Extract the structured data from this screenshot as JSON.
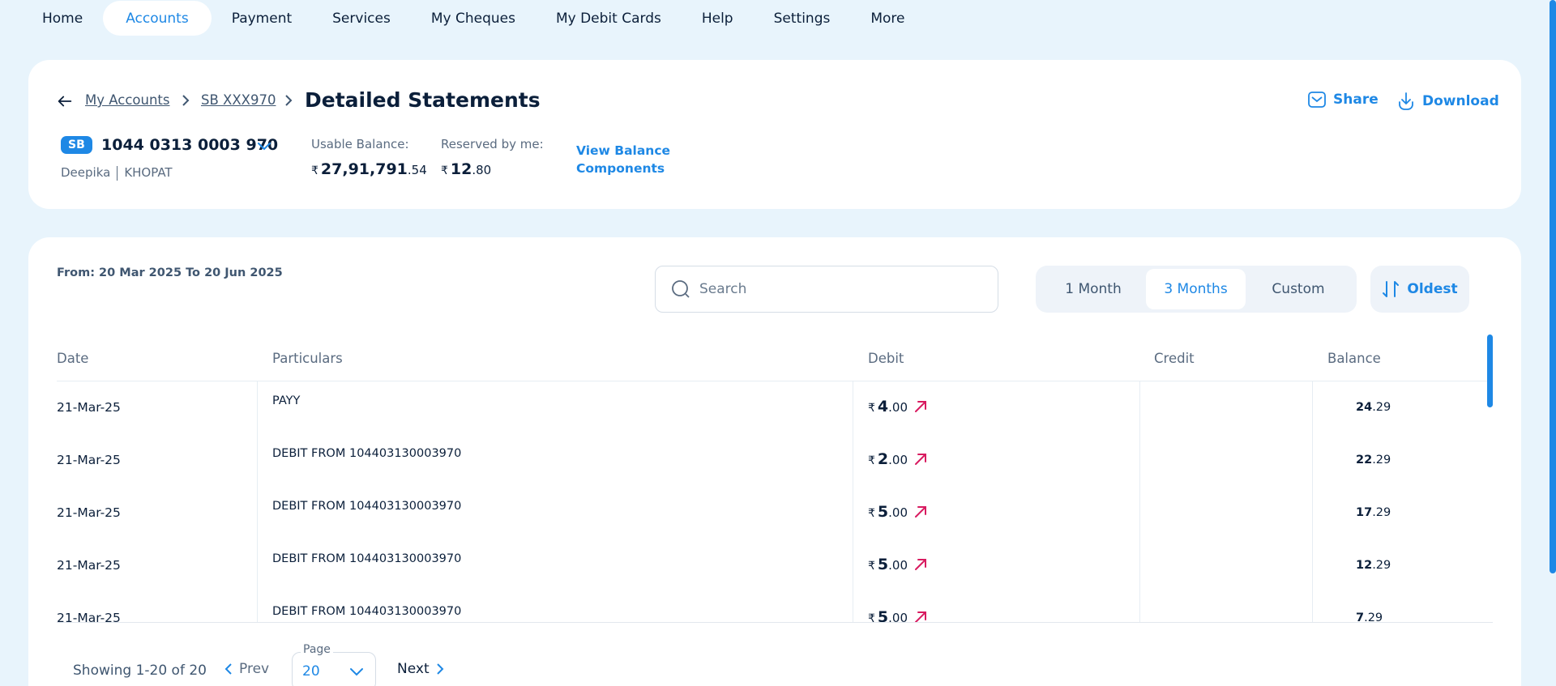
{
  "nav": {
    "items": [
      {
        "label": "Home"
      },
      {
        "label": "Accounts"
      },
      {
        "label": "Payment"
      },
      {
        "label": "Services"
      },
      {
        "label": "My Cheques"
      },
      {
        "label": "My Debit Cards"
      },
      {
        "label": "Help"
      },
      {
        "label": "Settings"
      },
      {
        "label": "More"
      }
    ],
    "active": "Accounts"
  },
  "breadcrumb": {
    "items": [
      "My Accounts",
      "SB XXX970"
    ],
    "title": "Detailed Statements"
  },
  "actions": {
    "share": "Share",
    "download": "Download"
  },
  "account": {
    "type_badge": "SB",
    "number": "1044 0313 0003 970",
    "holder_first": "Deepika",
    "holder_last": "KHOPAT"
  },
  "balances": {
    "usable_label": "Usable Balance:",
    "usable_currency": "₹",
    "usable_whole": "27,91,791",
    "usable_decimal": ".54",
    "reserved_label": "Reserved by me:",
    "reserved_currency": "₹",
    "reserved_whole": "12",
    "reserved_decimal": ".80",
    "view_components": "View Balance Components"
  },
  "filters": {
    "date_range": "From: 20 Mar 2025 To 20 Jun 2025",
    "search_placeholder": "Search",
    "periods": [
      "1 Month",
      "3 Months",
      "Custom"
    ],
    "active_period": "3 Months",
    "sort_label": "Oldest"
  },
  "table": {
    "columns": [
      "Date",
      "Particulars",
      "Debit",
      "Credit",
      "Balance"
    ],
    "rows": [
      {
        "date": "21-Mar-25",
        "particulars": "PAYY",
        "debit_cur": "₹",
        "debit_whole": "4",
        "debit_dec": ".00",
        "credit": "",
        "bal_whole": "24",
        "bal_dec": ".29"
      },
      {
        "date": "21-Mar-25",
        "particulars": "DEBIT FROM 104403130003970",
        "debit_cur": "₹",
        "debit_whole": "2",
        "debit_dec": ".00",
        "credit": "",
        "bal_whole": "22",
        "bal_dec": ".29"
      },
      {
        "date": "21-Mar-25",
        "particulars": "DEBIT FROM 104403130003970",
        "debit_cur": "₹",
        "debit_whole": "5",
        "debit_dec": ".00",
        "credit": "",
        "bal_whole": "17",
        "bal_dec": ".29"
      },
      {
        "date": "21-Mar-25",
        "particulars": "DEBIT FROM 104403130003970",
        "debit_cur": "₹",
        "debit_whole": "5",
        "debit_dec": ".00",
        "credit": "",
        "bal_whole": "12",
        "bal_dec": ".29"
      },
      {
        "date": "21-Mar-25",
        "particulars": "DEBIT FROM 104403130003970",
        "debit_cur": "₹",
        "debit_whole": "5",
        "debit_dec": ".00",
        "credit": "",
        "bal_whole": "7",
        "bal_dec": ".29"
      }
    ]
  },
  "pager": {
    "showing": "Showing 1-20 of 20",
    "prev": "Prev",
    "page_label": "Page",
    "page_value": "20",
    "next": "Next"
  },
  "colors": {
    "accent": "#1e88e5",
    "debit_arrow": "#d81b60",
    "background": "#e8f4fc"
  }
}
